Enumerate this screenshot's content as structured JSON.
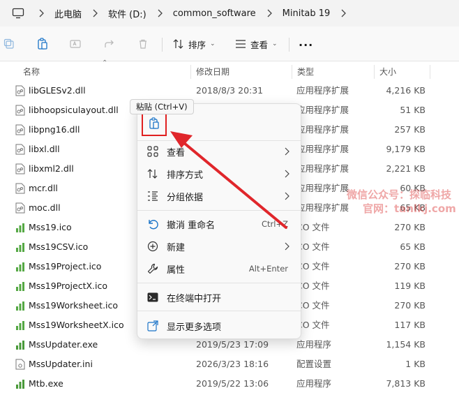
{
  "address_bar": {
    "crumbs": [
      "此电脑",
      "软件 (D:)",
      "common_software",
      "Minitab 19"
    ]
  },
  "toolbar": {
    "sort_label": "排序",
    "view_label": "查看",
    "more_label": "..."
  },
  "columns": {
    "name": "名称",
    "date": "修改日期",
    "type": "类型",
    "size": "大小"
  },
  "files": [
    {
      "name": "libGLESv2.dll",
      "date": "2018/8/3 20:31",
      "type": "应用程序扩展",
      "size": "4,216 KB",
      "icon": "dll-icon"
    },
    {
      "name": "libhoopsiculayout.dll",
      "date": "",
      "type": "应用程序扩展",
      "size": "51 KB",
      "icon": "dll-icon"
    },
    {
      "name": "libpng16.dll",
      "date": "",
      "type": "应用程序扩展",
      "size": "257 KB",
      "icon": "dll-icon"
    },
    {
      "name": "libxl.dll",
      "date": "",
      "type": "应用程序扩展",
      "size": "9,179 KB",
      "icon": "dll-icon"
    },
    {
      "name": "libxml2.dll",
      "date": "",
      "type": "应用程序扩展",
      "size": "2,221 KB",
      "icon": "dll-icon"
    },
    {
      "name": "mcr.dll",
      "date": "",
      "type": "应用程序扩展",
      "size": "60 KB",
      "icon": "dll-icon"
    },
    {
      "name": "moc.dll",
      "date": "",
      "type": "应用程序扩展",
      "size": "65 KB",
      "icon": "dll-icon"
    },
    {
      "name": "Mss19.ico",
      "date": "",
      "type": "CO 文件",
      "size": "270 KB",
      "icon": "chart-ico-icon"
    },
    {
      "name": "Mss19CSV.ico",
      "date": "",
      "type": "CO 文件",
      "size": "65 KB",
      "icon": "chart-ico-icon"
    },
    {
      "name": "Mss19Project.ico",
      "date": "",
      "type": "CO 文件",
      "size": "270 KB",
      "icon": "chart-ico-icon"
    },
    {
      "name": "Mss19ProjectX.ico",
      "date": "",
      "type": "CO 文件",
      "size": "119 KB",
      "icon": "chart-ico-icon"
    },
    {
      "name": "Mss19Worksheet.ico",
      "date": "",
      "type": "CO 文件",
      "size": "270 KB",
      "icon": "chart-ico-icon"
    },
    {
      "name": "Mss19WorksheetX.ico",
      "date": "",
      "type": "CO 文件",
      "size": "117 KB",
      "icon": "chart-ico-icon"
    },
    {
      "name": "MssUpdater.exe",
      "date": "2019/5/23 17:09",
      "type": "应用程序",
      "size": "1,154 KB",
      "icon": "chart-exe-icon"
    },
    {
      "name": "MssUpdater.ini",
      "date": "2026/3/23 18:16",
      "type": "配置设置",
      "size": "1 KB",
      "icon": "ini-icon"
    },
    {
      "name": "Mtb.exe",
      "date": "2019/5/22 13:06",
      "type": "应用程序",
      "size": "7,813 KB",
      "icon": "chart-exe-icon"
    }
  ],
  "context_menu": {
    "tooltip": "粘贴 (Ctrl+V)",
    "items": [
      {
        "label": "查看",
        "shortcut": "",
        "submenu": true,
        "icon": "grid-view-icon"
      },
      {
        "label": "排序方式",
        "shortcut": "",
        "submenu": true,
        "icon": "sort-icon"
      },
      {
        "label": "分组依据",
        "shortcut": "",
        "submenu": true,
        "icon": "group-icon"
      },
      {
        "label": "撤消 重命名",
        "shortcut": "Ctrl+Z",
        "submenu": false,
        "icon": "undo-icon"
      },
      {
        "label": "新建",
        "shortcut": "",
        "submenu": true,
        "icon": "new-icon"
      },
      {
        "label": "属性",
        "shortcut": "Alt+Enter",
        "submenu": false,
        "icon": "wrench-icon"
      },
      {
        "label": "在终端中打开",
        "shortcut": "",
        "submenu": false,
        "icon": "terminal-icon"
      },
      {
        "label": "显示更多选项",
        "shortcut": "",
        "submenu": false,
        "icon": "share-more-icon"
      }
    ]
  },
  "watermark": {
    "line1": "微信公众号：探临科技",
    "line2": "官网：tanlkj.com"
  },
  "colors": {
    "accent": "#0067c0",
    "highlight_red": "#e02020"
  }
}
